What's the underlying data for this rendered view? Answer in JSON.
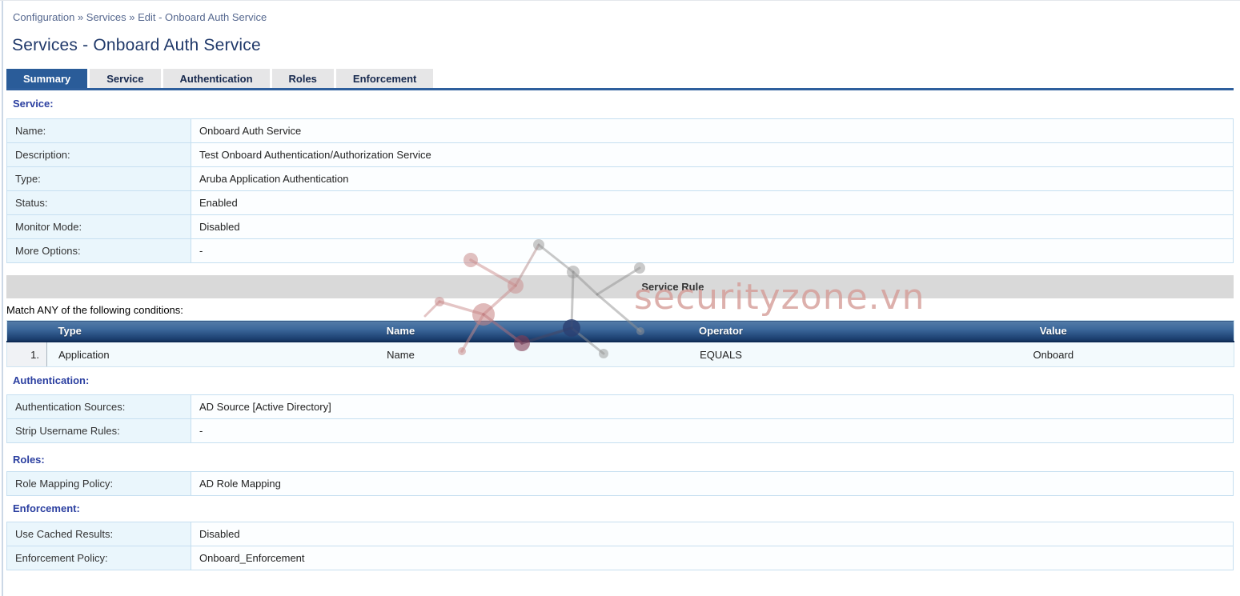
{
  "breadcrumb": "Configuration » Services » Edit - Onboard Auth Service",
  "page_title": "Services - Onboard Auth Service",
  "tabs": [
    {
      "label": "Summary",
      "active": true
    },
    {
      "label": "Service",
      "active": false
    },
    {
      "label": "Authentication",
      "active": false
    },
    {
      "label": "Roles",
      "active": false
    },
    {
      "label": "Enforcement",
      "active": false
    }
  ],
  "service_section": {
    "heading": "Service:",
    "rows": [
      {
        "label": "Name:",
        "value": "Onboard Auth Service"
      },
      {
        "label": "Description:",
        "value": "Test Onboard Authentication/Authorization Service"
      },
      {
        "label": "Type:",
        "value": "Aruba Application Authentication"
      },
      {
        "label": "Status:",
        "value": "Enabled"
      },
      {
        "label": "Monitor Mode:",
        "value": "Disabled"
      },
      {
        "label": "More Options:",
        "value": "-"
      }
    ]
  },
  "service_rule": {
    "bar_title": "Service Rule",
    "match_text": "Match ANY of the following conditions:",
    "columns": {
      "type": "Type",
      "name": "Name",
      "operator": "Operator",
      "value": "Value"
    },
    "rows": [
      {
        "num": "1.",
        "type": "Application",
        "name": "Name",
        "operator": "EQUALS",
        "value": "Onboard"
      }
    ]
  },
  "authentication_section": {
    "heading": "Authentication:",
    "rows": [
      {
        "label": "Authentication Sources:",
        "value": "AD Source [Active Directory]"
      },
      {
        "label": "Strip Username Rules:",
        "value": "-"
      }
    ]
  },
  "roles_section": {
    "heading": "Roles:",
    "rows": [
      {
        "label": "Role Mapping Policy:",
        "value": "AD Role Mapping"
      }
    ]
  },
  "enforcement_section": {
    "heading": "Enforcement:",
    "rows": [
      {
        "label": "Use Cached Results:",
        "value": "Disabled"
      },
      {
        "label": "Enforcement Policy:",
        "value": "Onboard_Enforcement"
      }
    ]
  },
  "watermark": {
    "text": "securityzone.vn"
  },
  "colors": {
    "active_tab_blue": "#2a5c99",
    "tab_underline": "#2e5f9d",
    "section_heading_blue": "#2b3fa0",
    "table_header_top": "#547ca8",
    "table_header_bottom": "#16355f",
    "label_cell_bg": "#eaf6fc",
    "rule_bar_gray": "#d9d9d9",
    "watermark_pink": "#d59d98"
  }
}
